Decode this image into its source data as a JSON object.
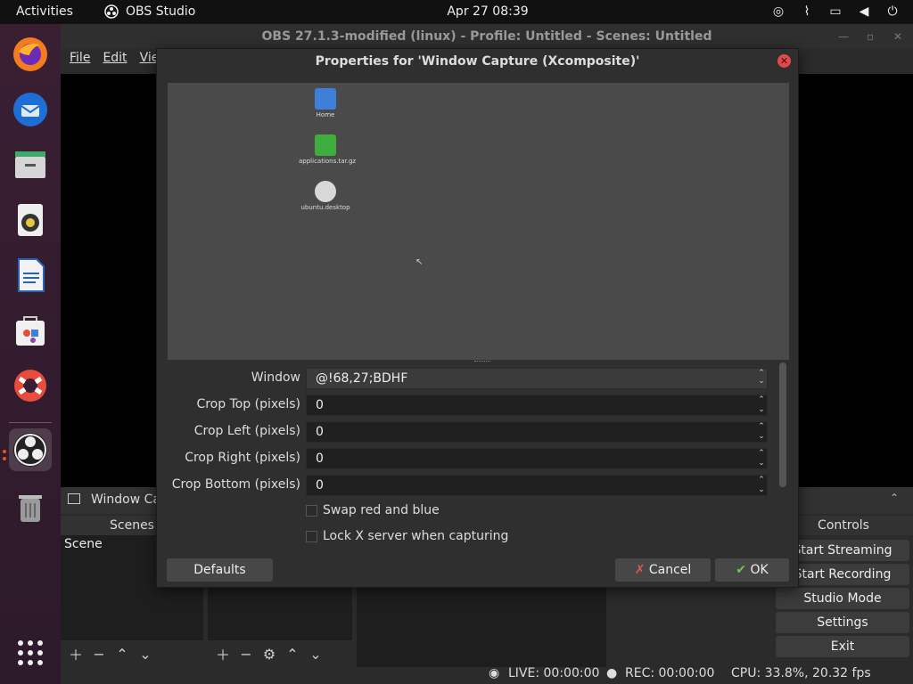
{
  "topbar": {
    "activities": "Activities",
    "app_name": "OBS Studio",
    "clock": "Apr 27  08:39"
  },
  "obs": {
    "window_title": "OBS 27.1.3-modified (linux) - Profile: Untitled - Scenes: Untitled",
    "menu": {
      "file": "File",
      "edit": "Edit",
      "view": "Vie"
    },
    "source_toolbar_title": "Window Ca",
    "docks": {
      "scenes_title": "Scenes",
      "scene_item": "Scene",
      "controls_title": "Controls"
    },
    "controls": {
      "start_streaming": "Start Streaming",
      "start_recording": "Start Recording",
      "studio_mode": "Studio Mode",
      "settings": "Settings",
      "exit": "Exit"
    },
    "status": {
      "live": "LIVE: 00:00:00",
      "rec": "REC: 00:00:00",
      "cpu": "CPU: 33.8%, 20.32 fps"
    }
  },
  "dialog": {
    "title": "Properties for 'Window Capture (Xcomposite)'",
    "preview_icons": [
      {
        "label": "Home",
        "color": "#3d7fd9"
      },
      {
        "label": "applications.tar.gz",
        "color": "#3fae3f"
      },
      {
        "label": "ubuntu.desktop",
        "color": "#d8d8d8"
      }
    ],
    "properties": {
      "window_label": "Window",
      "window_value": "@!68,27;BDHF",
      "crop_top_label": "Crop Top (pixels)",
      "crop_top_value": "0",
      "crop_left_label": "Crop Left (pixels)",
      "crop_left_value": "0",
      "crop_right_label": "Crop Right (pixels)",
      "crop_right_value": "0",
      "crop_bottom_label": "Crop Bottom (pixels)",
      "crop_bottom_value": "0",
      "swap_label": "Swap red and blue",
      "lock_label": "Lock X server when capturing"
    },
    "buttons": {
      "defaults": "Defaults",
      "cancel": "Cancel",
      "ok": "OK"
    }
  },
  "colors": {
    "accent": "#e95420",
    "close": "#e04a4a"
  }
}
